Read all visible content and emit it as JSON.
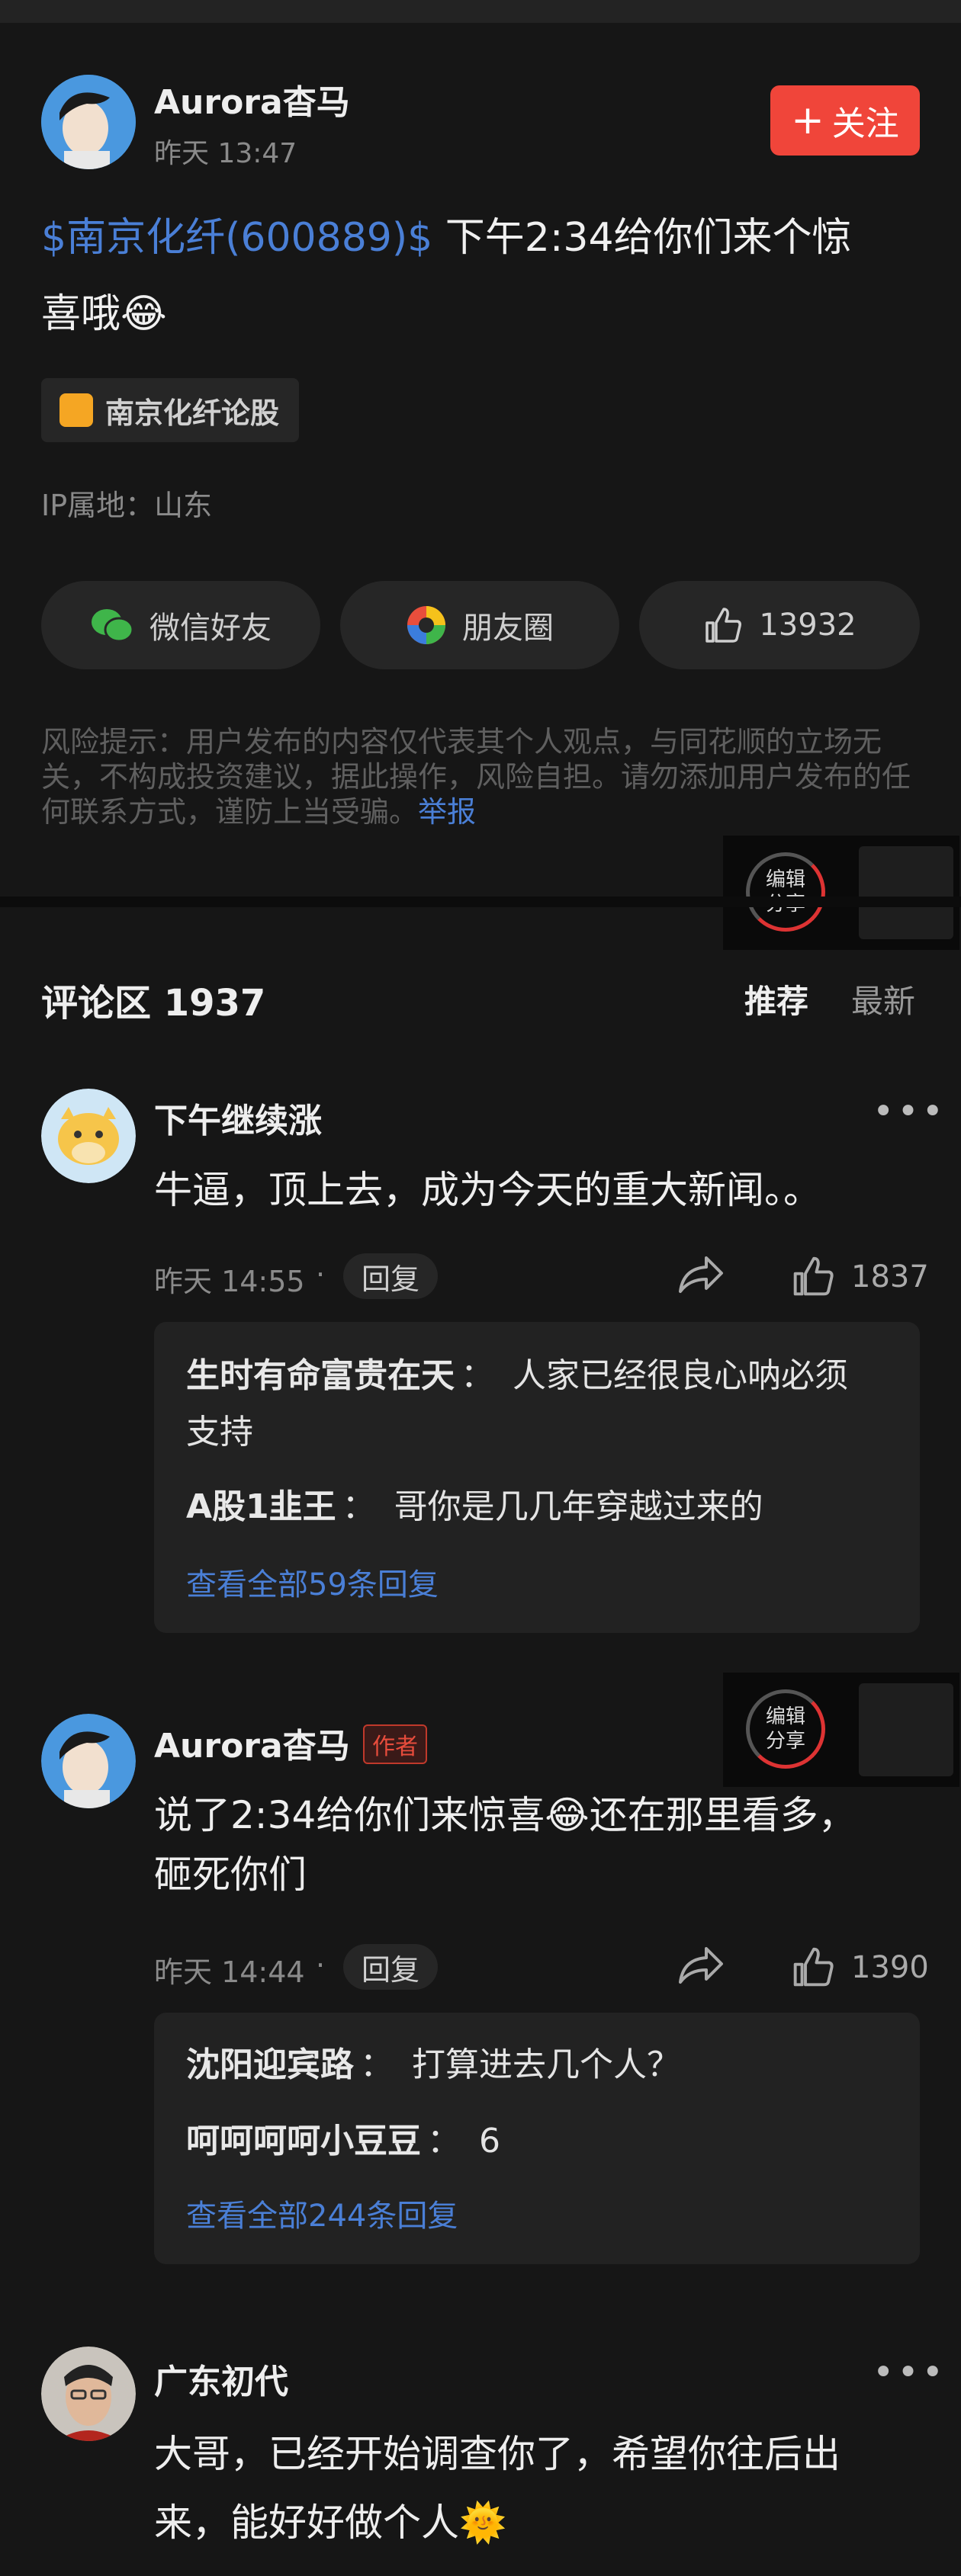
{
  "post": {
    "author": "Aurora杳马",
    "time": "昨天 13:47",
    "follow_label": "关注",
    "follow_icon": "plus-icon",
    "stock": "$南京化纤(600889)$",
    "text_line1": " 下午2:34给你们来个惊",
    "text_line2": "喜哦😂",
    "tag": "南京化纤论股",
    "ip": "IP属地：山东"
  },
  "share": {
    "wechat": "微信好友",
    "moments": "朋友圈",
    "likes": "13932"
  },
  "risk": {
    "text": "风险提示：用户发布的内容仅代表其个人观点，与同花顺的立场无关，不构成投资建议，据此操作，风险自担。请勿添加用户发布的任何联系方式，谨防上当受骗。",
    "report": "举报"
  },
  "overlay": {
    "label1": "编辑",
    "label2": "分享"
  },
  "comments_header": {
    "title": "评论区 1937",
    "tab_recommended": "推荐",
    "tab_latest": "最新"
  },
  "comments": [
    {
      "user": "下午继续涨",
      "text": "牛逼，顶上去，成为今天的重大新闻。。",
      "time": "昨天 14:55",
      "reply_label": "回复",
      "likes": "1837",
      "replies": [
        {
          "user": "生时有命富贵在天",
          "sep": "：",
          "text": "人家已经很良心呐必须",
          "text2": "支持"
        },
        {
          "user": "A股1韭王",
          "sep": "：",
          "text": "哥你是几几年穿越过来的"
        }
      ],
      "more": "查看全部59条回复"
    },
    {
      "user": "Aurora杳马",
      "badge": "作者",
      "text_line1": "说了2:34给你们来惊喜😂还在那里看多，",
      "text_line2": "砸死你们",
      "time": "昨天 14:44",
      "reply_label": "回复",
      "likes": "1390",
      "replies": [
        {
          "user": "沈阳迎宾路",
          "sep": "：",
          "text": "打算进去几个人？"
        },
        {
          "user": "呵呵呵呵小豆豆",
          "sep": "：",
          "text": "6"
        }
      ],
      "more": "查看全部244条回复"
    },
    {
      "user": "广东初代",
      "text_line1": "大哥，已经开始调查你了，希望你往后出",
      "text_line2": "来，能好好做个人🌞"
    }
  ]
}
